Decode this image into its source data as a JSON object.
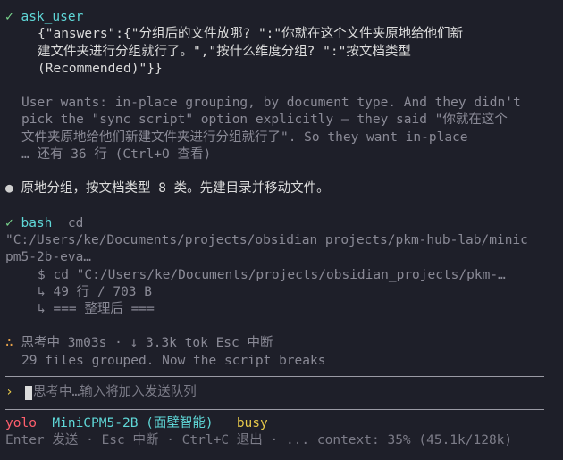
{
  "ask_user": {
    "check": "✓",
    "tool": "ask_user",
    "answer_lines": [
      "{\"answers\":{\"分组后的文件放哪? \":\"你就在这个文件夹原地给他们新",
      "建文件夹进行分组就行了。\",\"按什么维度分组? \":\"按文档类型",
      "(Recommended)\"}}"
    ],
    "reasoning_lines": [
      "User wants: in-place grouping, by document type. And they didn't",
      "pick the \"sync script\" option explicitly — they said \"你就在这个",
      "文件夹原地给他们新建文件夹进行分组就行了\". So they want in-place",
      "… 还有 36 行 (Ctrl+O 查看)"
    ]
  },
  "message": {
    "bullet": "●",
    "text": "原地分组，按文档类型 8 类。先建目录并移动文件。"
  },
  "bash": {
    "check": "✓",
    "tool": "bash",
    "cmd_first": "cd",
    "cmd_lines": [
      "\"C:/Users/ke/Documents/projects/obsidian_projects/pkm-hub-lab/minic",
      "pm5-2b-eva…"
    ],
    "output_lines": [
      "$ cd \"C:/Users/ke/Documents/projects/obsidian_projects/pkm-…",
      "↳ 49 行 / 703 B",
      "↳ === 整理后 ==="
    ]
  },
  "thinking": {
    "icon": "∴",
    "label": "思考中 3m03s · ↓ 3.3k tok Esc 中断",
    "detail": "29 files grouped. Now the script breaks"
  },
  "input": {
    "prompt": "›",
    "placeholder": "思考中…输入将加入发送队列"
  },
  "status": {
    "mode": "yolo",
    "model": "MiniCPM5-2B (面壁智能)",
    "state": "busy",
    "hints": "Enter 发送 · Esc 中断 · Ctrl+C 退出 · ... context: 35% (45.1k/128k)"
  },
  "colors": {
    "background": "#1e1f29",
    "success": "#7bd88f",
    "tool": "#5fd7d7",
    "mode": "#ff5f6d",
    "busy": "#e6c84a"
  }
}
